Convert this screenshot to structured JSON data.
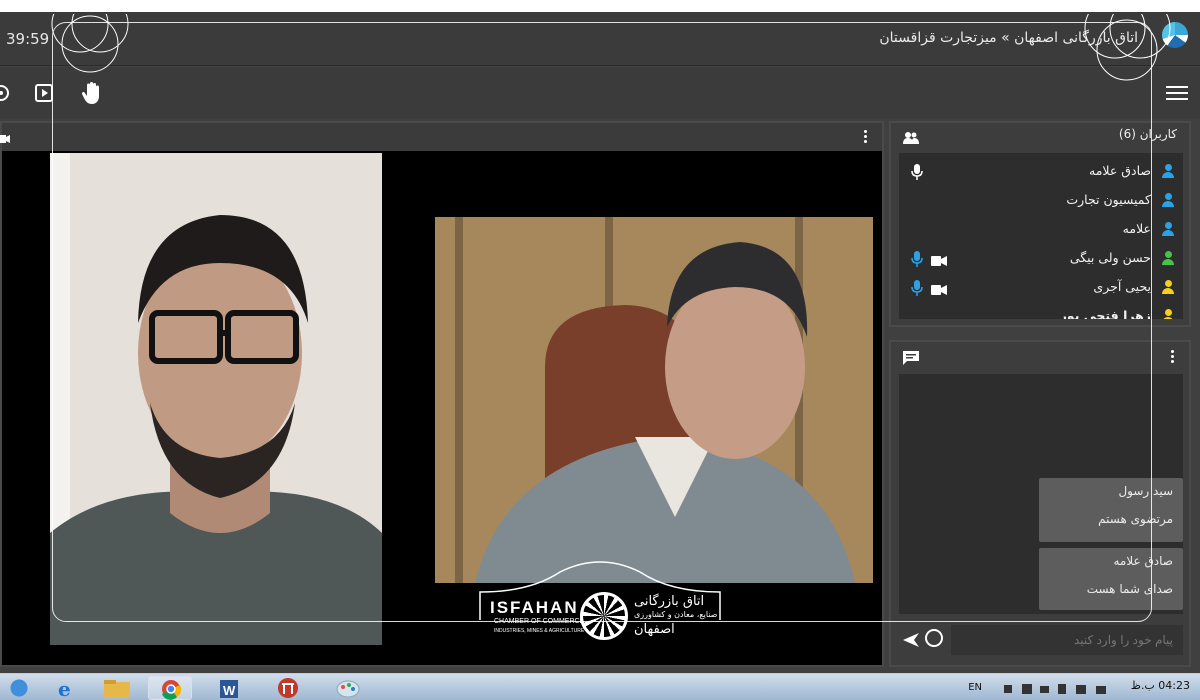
{
  "header": {
    "timer": "39:59",
    "title": "اتاق بازرگانی اصفهان » میزتجارت قزاقستان"
  },
  "users": {
    "title": "کاربران (6)",
    "items": [
      {
        "name": "صادق علامه",
        "icon_color": "#2aa3e6",
        "mic": true,
        "cam": false
      },
      {
        "name": "کمیسیون تجارت",
        "icon_color": "#2aa3e6",
        "mic": false,
        "cam": false
      },
      {
        "name": "علامه",
        "icon_color": "#2aa3e6",
        "mic": false,
        "cam": false
      },
      {
        "name": "حسن ولی بیگی",
        "icon_color": "#49c24a",
        "mic": true,
        "cam": true
      },
      {
        "name": "یحیی آجری",
        "icon_color": "#f4cf1d",
        "mic": true,
        "cam": true
      },
      {
        "name": "زهرا فتحی پور",
        "icon_color": "#f4cf1d",
        "mic": false,
        "cam": false
      }
    ]
  },
  "chat": {
    "messages": [
      {
        "sender": "سید رسول",
        "text": "مرتضوی هستم"
      },
      {
        "sender": "صادق علامه",
        "text": "صدای شما هست"
      }
    ],
    "input_placeholder": "پیام خود را وارد کنید"
  },
  "branding": {
    "en_name": "ISFAHAN",
    "en_line1": "CHAMBER OF COMMERCE",
    "en_line2": "INDUSTRIES, MINES & AGRICULTURE",
    "fa_line1": "اتاق بازرگانی",
    "fa_line2": "صنایع، معادن و کشاورزی",
    "fa_line3": "اصفهان"
  },
  "taskbar": {
    "lang": "EN",
    "time": "04:23 ب.ظ"
  },
  "colors": {
    "accent_blue": "#2aa3e6",
    "user_green": "#49c24a",
    "user_yellow": "#f4cf1d"
  }
}
